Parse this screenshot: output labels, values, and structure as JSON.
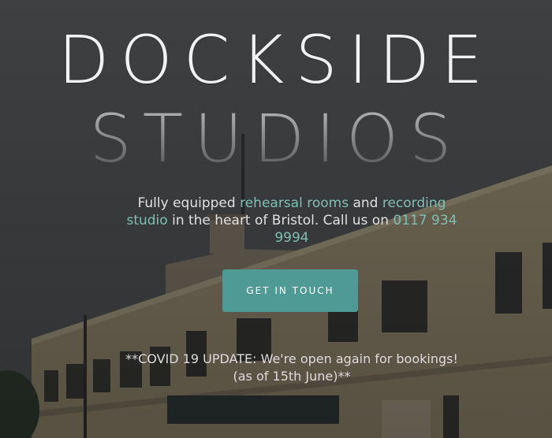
{
  "hero": {
    "title_line1": "DOCKSIDE",
    "title_line2": "STUDIOS",
    "tagline": {
      "part1": "Fully equipped ",
      "link_rehearsal": "rehearsal rooms",
      "part2": " and ",
      "link_recording": "recording studio",
      "part3": " in the heart of Bristol. Call us on ",
      "link_phone": "0117 934 9994"
    },
    "cta_label": "GET IN TOUCH",
    "covid_notice": "**COVID 19 UPDATE: We're open again for bookings! (as of 15th June)**"
  },
  "colors": {
    "accent": "#4f9a94",
    "link": "#7fbfb3",
    "text": "#e0e0e0"
  }
}
